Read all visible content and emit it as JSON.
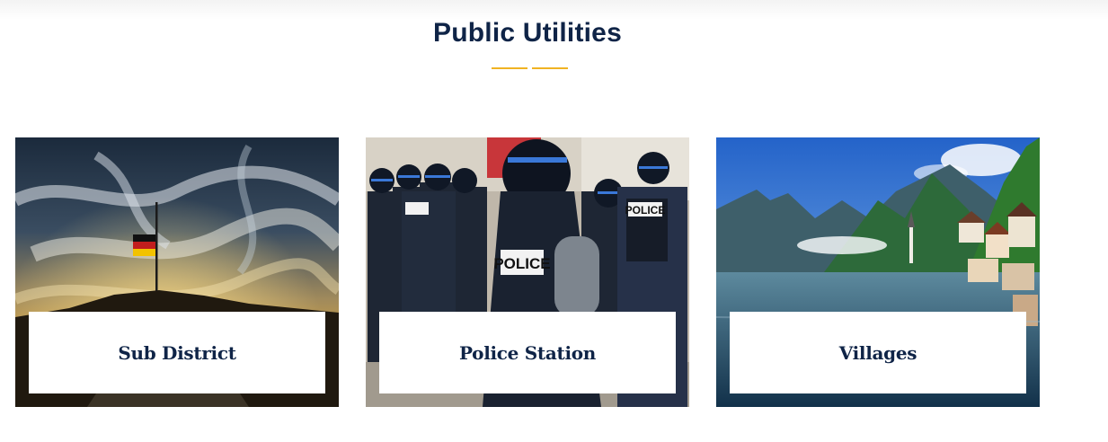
{
  "section": {
    "title": "Public Utilities",
    "accent_color": "#f0b323",
    "title_color": "#0f2447"
  },
  "cards": [
    {
      "label": "Sub District",
      "image": "flag-on-hill-sunset-photo"
    },
    {
      "label": "Police Station",
      "image": "riot-police-officers-photo",
      "badge_text": "POLICE"
    },
    {
      "label": "Villages",
      "image": "alpine-lake-village-photo"
    }
  ]
}
